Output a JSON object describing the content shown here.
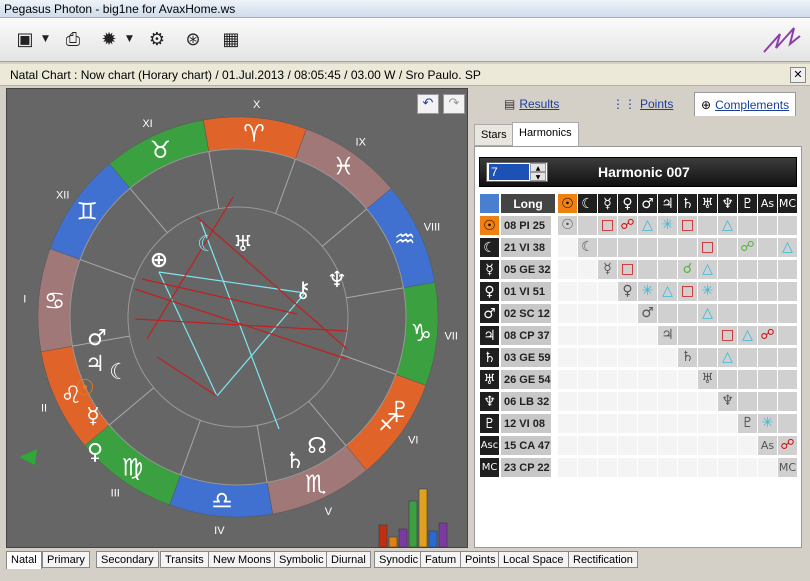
{
  "window": {
    "title": "Pegasus Photon   -   big1ne for AvaxHome.ws"
  },
  "toolbar": {
    "buttons": [
      {
        "name": "new-chart-icon",
        "glyph": "▣"
      },
      {
        "name": "print-icon",
        "glyph": "⎙"
      },
      {
        "name": "settings-icon",
        "glyph": "✹"
      },
      {
        "name": "tools-icon",
        "glyph": "⚙"
      },
      {
        "name": "wheel-icon",
        "glyph": "⊛"
      },
      {
        "name": "calendar-icon",
        "glyph": "▦"
      }
    ]
  },
  "info": {
    "text": "Natal Chart :  Now chart (Horary chart) /  01.Jul.2013 /  08:05:45 / 03.00 W /  Sro Paulo. SP"
  },
  "wheel": {
    "house_labels": [
      "X",
      "IX",
      "VIII",
      "VII",
      "VI",
      "V",
      "IV",
      "III",
      "II",
      "I",
      "XII",
      "XI"
    ],
    "signs": [
      "♈",
      "♓",
      "♒",
      "♑",
      "♐",
      "♏",
      "♎",
      "♍",
      "♌",
      "♋",
      "♊",
      "♉"
    ],
    "planets": [
      {
        "glyph": "☾",
        "color": "#7fe6f0"
      },
      {
        "glyph": "♅",
        "color": "#ffffff"
      },
      {
        "glyph": "⊕",
        "color": "#ffffff"
      },
      {
        "glyph": "♆",
        "color": "#ffffff"
      },
      {
        "glyph": "⚷",
        "color": "#ffffff"
      },
      {
        "glyph": "♂",
        "color": "#ffffff"
      },
      {
        "glyph": "♃",
        "color": "#ffffff"
      },
      {
        "glyph": "☾",
        "color": "#ffffff"
      },
      {
        "glyph": "☉",
        "color": "#f07a1c"
      },
      {
        "glyph": "☿",
        "color": "#ffffff"
      },
      {
        "glyph": "♀",
        "color": "#ffffff"
      },
      {
        "glyph": "♇",
        "color": "#ffffff"
      },
      {
        "glyph": "♄",
        "color": "#ffffff"
      },
      {
        "glyph": "☊",
        "color": "#ffffff"
      }
    ],
    "undo_glyph": "↶",
    "redo_glyph": "↷"
  },
  "right": {
    "tabs": [
      {
        "label": "Results",
        "icon": "results-icon"
      },
      {
        "label": "Points",
        "icon": "points-icon"
      },
      {
        "label": "Complements",
        "icon": "complements-icon"
      }
    ],
    "subtabs": [
      "Stars",
      "Harmonics"
    ],
    "harmonic": {
      "value": "7",
      "title": "Harmonic  007"
    },
    "columns_header": "Long",
    "column_glyphs": [
      "☉",
      "☾",
      "☿",
      "♀",
      "♂",
      "♃",
      "♄",
      "♅",
      "♆",
      "♇",
      "As",
      "MC"
    ],
    "rows": [
      {
        "glyph": "☉",
        "long": "08 PI 25"
      },
      {
        "glyph": "☾",
        "long": "21 VI 38"
      },
      {
        "glyph": "☿",
        "long": "05 GE 32"
      },
      {
        "glyph": "♀",
        "long": "01 VI 51"
      },
      {
        "glyph": "♂",
        "long": "02 SC 12"
      },
      {
        "glyph": "♃",
        "long": "08 CP 37"
      },
      {
        "glyph": "♄",
        "long": "03 GE 59"
      },
      {
        "glyph": "♅",
        "long": "26 GE 54"
      },
      {
        "glyph": "♆",
        "long": "06 LB 32"
      },
      {
        "glyph": "♇",
        "long": "12 VI 08"
      },
      {
        "glyph": "Asc",
        "long": "15 CA 47"
      },
      {
        "glyph": "MC",
        "long": "23 CP 22"
      }
    ],
    "aspects": [
      [
        0,
        0,
        "☉",
        "#555"
      ],
      [
        0,
        2,
        "□",
        "#d01010"
      ],
      [
        0,
        3,
        "☍",
        "#d01010"
      ],
      [
        0,
        4,
        "△",
        "#3ab8d8"
      ],
      [
        0,
        5,
        "✳",
        "#3ab8d8"
      ],
      [
        0,
        6,
        "□",
        "#d01010"
      ],
      [
        0,
        8,
        "△",
        "#3ab8d8"
      ],
      [
        1,
        1,
        "☾",
        "#555"
      ],
      [
        1,
        7,
        "□",
        "#d01010"
      ],
      [
        1,
        9,
        "☍",
        "#60b040"
      ],
      [
        1,
        11,
        "△",
        "#3ab8d8"
      ],
      [
        2,
        2,
        "☿",
        "#555"
      ],
      [
        2,
        3,
        "□",
        "#d01010"
      ],
      [
        2,
        6,
        "☌",
        "#60b040"
      ],
      [
        2,
        7,
        "△",
        "#3ab8d8"
      ],
      [
        3,
        3,
        "♀",
        "#555"
      ],
      [
        3,
        4,
        "✳",
        "#3ab8d8"
      ],
      [
        3,
        5,
        "△",
        "#3ab8d8"
      ],
      [
        3,
        6,
        "□",
        "#d01010"
      ],
      [
        3,
        7,
        "✳",
        "#3ab8d8"
      ],
      [
        4,
        4,
        "♂",
        "#555"
      ],
      [
        4,
        7,
        "△",
        "#3ab8d8"
      ],
      [
        5,
        5,
        "♃",
        "#555"
      ],
      [
        5,
        8,
        "□",
        "#d01010"
      ],
      [
        5,
        9,
        "△",
        "#3ab8d8"
      ],
      [
        5,
        10,
        "☍",
        "#d01010"
      ],
      [
        6,
        6,
        "♄",
        "#555"
      ],
      [
        6,
        8,
        "△",
        "#3ab8d8"
      ],
      [
        7,
        7,
        "♅",
        "#555"
      ],
      [
        8,
        8,
        "♆",
        "#555"
      ],
      [
        9,
        9,
        "♇",
        "#555"
      ],
      [
        9,
        10,
        "✳",
        "#3ab8d8"
      ],
      [
        10,
        10,
        "As",
        "#555"
      ],
      [
        10,
        11,
        "☍",
        "#d01010"
      ],
      [
        11,
        11,
        "MC",
        "#555"
      ]
    ]
  },
  "bottom_tabs": [
    "Natal",
    "Primary",
    "Secondary",
    "Transits",
    "New Moons",
    "Symbolic",
    "Diurnal",
    "Synodic",
    "Fatum",
    "Points",
    "Local Space",
    "Rectification"
  ],
  "colors": {
    "fire": "#e0642a",
    "earth": "#a07878",
    "air": "#4070d0",
    "water": "#3aa040"
  }
}
